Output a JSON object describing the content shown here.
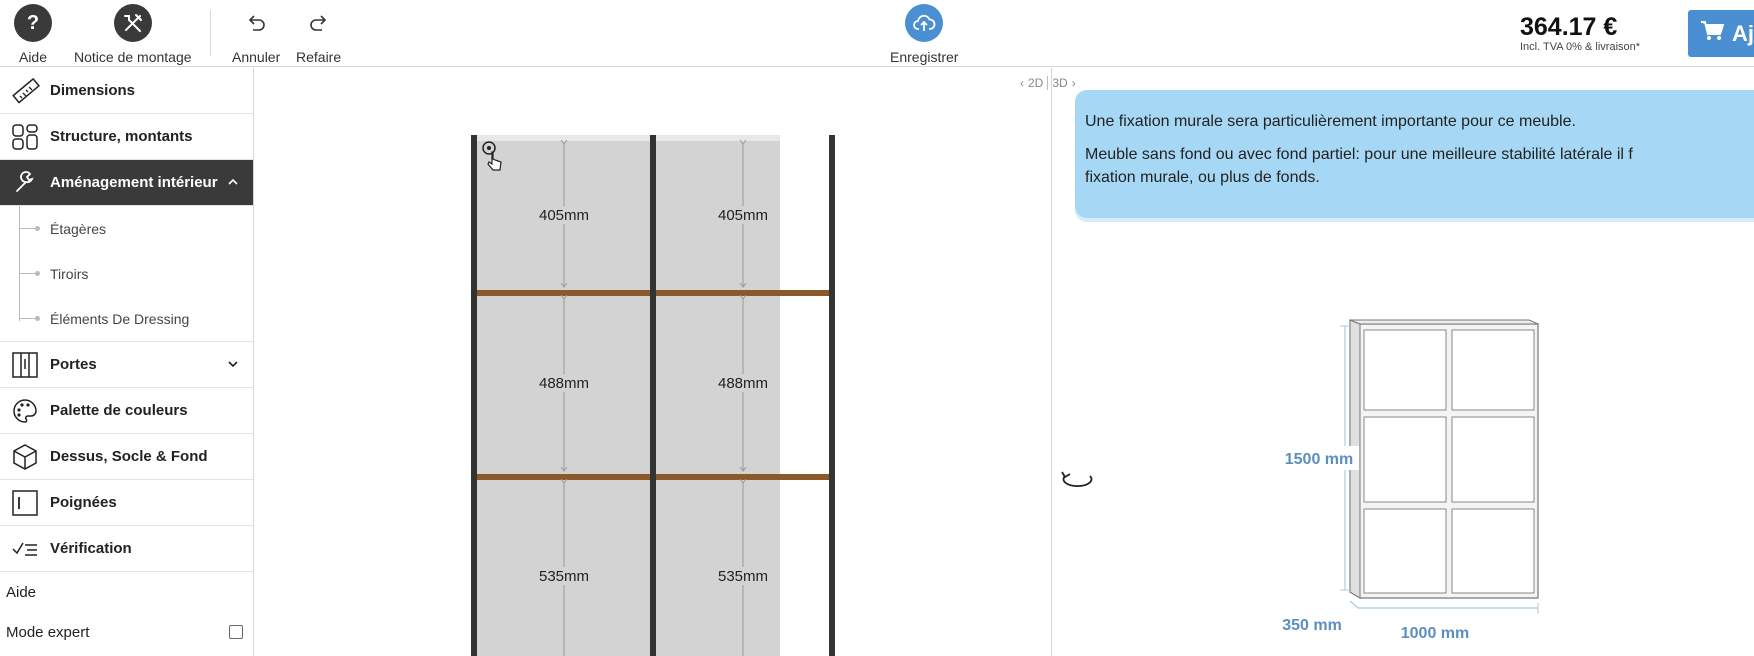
{
  "toolbar": {
    "help_label": "Aide",
    "help_glyph": "?",
    "manual_label": "Notice de montage",
    "undo_label": "Annuler",
    "redo_label": "Refaire",
    "save_label": "Enregistrer"
  },
  "price": {
    "value": "364.17 €",
    "note": "Incl. TVA 0% & livraison*"
  },
  "cart": {
    "label": "Ajo"
  },
  "sidebar": {
    "items": [
      {
        "label": "Dimensions"
      },
      {
        "label": "Structure, montants"
      },
      {
        "label": "Aménagement intérieur"
      }
    ],
    "subitems": [
      {
        "label": "Étagères"
      },
      {
        "label": "Tiroirs"
      },
      {
        "label": "Éléments De Dressing"
      }
    ],
    "items2": [
      {
        "label": "Portes"
      },
      {
        "label": "Palette de couleurs"
      },
      {
        "label": "Dessus, Socle & Fond"
      },
      {
        "label": "Poignées"
      },
      {
        "label": "Vérification"
      }
    ],
    "help_label": "Aide",
    "expert_label": "Mode expert"
  },
  "view_toggle": {
    "two_d": "2D",
    "three_d": "3D"
  },
  "cabinet_2d": {
    "columns": 2,
    "compartment_heights_mm": [
      "405mm",
      "488mm",
      "535mm"
    ]
  },
  "info": {
    "line1": "Une fixation murale sera particulièrement importante pour ce meuble.",
    "line2": "Meuble sans fond ou avec fond partiel: pour une meilleure stabilité latérale il f",
    "line3": "fixation murale, ou plus de fonds."
  },
  "preview_3d": {
    "height": "1500 mm",
    "depth": "350 mm",
    "width": "1000 mm"
  },
  "colors": {
    "accent": "#4a8fd1",
    "dark": "#3a3a3a",
    "info_bg": "#a6d8f5",
    "shelf": "#8b5a2b",
    "dimension_text": "#5a8fc0"
  }
}
